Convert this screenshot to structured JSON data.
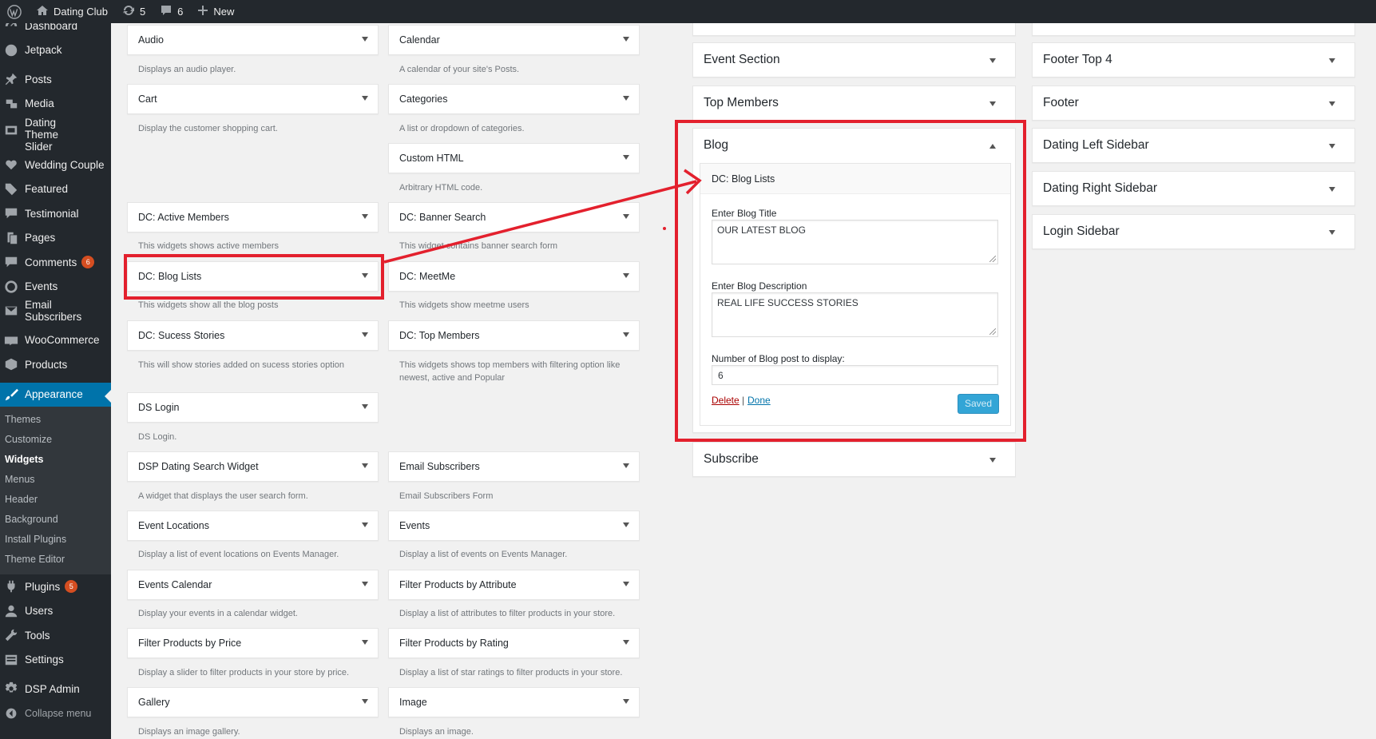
{
  "adminbar": {
    "site_name": "Dating Club",
    "updates_count": "5",
    "comments_count": "6",
    "new_label": "New"
  },
  "menu": {
    "items": [
      {
        "label": "Dashboard",
        "icon": "dashboard-icon"
      },
      {
        "label": "Jetpack",
        "icon": "jetpack-icon"
      },
      {
        "label": "Posts",
        "icon": "pin-icon"
      },
      {
        "label": "Media",
        "icon": "media-icon"
      },
      {
        "label": "Dating Theme Slider",
        "icon": "slider-icon"
      },
      {
        "label": "Wedding Couple",
        "icon": "heart-icon"
      },
      {
        "label": "Featured",
        "icon": "tag-icon"
      },
      {
        "label": "Testimonial",
        "icon": "speech-bubble-icon"
      },
      {
        "label": "Pages",
        "icon": "pages-icon"
      },
      {
        "label": "Comments",
        "icon": "comment-icon",
        "badge": "6"
      },
      {
        "label": "Events",
        "icon": "events-icon"
      },
      {
        "label": "Email Subscribers",
        "icon": "email-icon"
      },
      {
        "label": "WooCommerce",
        "icon": "woocommerce-icon"
      },
      {
        "label": "Products",
        "icon": "products-icon"
      },
      {
        "label": "Appearance",
        "icon": "paintbrush-icon"
      },
      {
        "label": "Plugins",
        "icon": "plugin-icon",
        "badge": "5"
      },
      {
        "label": "Users",
        "icon": "users-icon"
      },
      {
        "label": "Tools",
        "icon": "wrench-icon"
      },
      {
        "label": "Settings",
        "icon": "settings-icon"
      },
      {
        "label": "DSP Admin",
        "icon": "gear-icon"
      },
      {
        "label": "Collapse menu",
        "icon": "collapse-icon"
      }
    ],
    "appearance_sub": [
      "Themes",
      "Customize",
      "Widgets",
      "Menus",
      "Header",
      "Background",
      "Install Plugins",
      "Theme Editor"
    ],
    "current_sub": "Widgets"
  },
  "available_widgets": {
    "left": [
      {
        "title": "Audio",
        "desc": "Displays an audio player."
      },
      {
        "title": "Cart",
        "desc": "Display the customer shopping cart."
      },
      {
        "title": "DC: Active Members",
        "desc": "This widgets shows active members"
      },
      {
        "title": "DC: Blog Lists",
        "desc": "This widgets show all the blog posts"
      },
      {
        "title": "DC: Sucess Stories",
        "desc": "This will show stories added on sucess stories option"
      },
      {
        "title": "DS Login",
        "desc": "DS Login."
      },
      {
        "title": "DSP Dating Search Widget",
        "desc": "A widget that displays the user search form."
      },
      {
        "title": "Event Locations",
        "desc": "Display a list of event locations on Events Manager."
      },
      {
        "title": "Events Calendar",
        "desc": "Display your events in a calendar widget."
      },
      {
        "title": "Filter Products by Price",
        "desc": "Display a slider to filter products in your store by price."
      },
      {
        "title": "Gallery",
        "desc": "Displays an image gallery."
      }
    ],
    "right": [
      {
        "title": "Calendar",
        "desc": "A calendar of your site's Posts."
      },
      {
        "title": "Categories",
        "desc": "A list or dropdown of categories."
      },
      {
        "title": "Custom HTML",
        "desc": "Arbitrary HTML code."
      },
      {
        "title": "DC: Banner Search",
        "desc": "This widget contains banner search form"
      },
      {
        "title": "DC: MeetMe",
        "desc": "This widgets show meetme users"
      },
      {
        "title": "DC: Top Members",
        "desc": "This widgets shows top members with filtering option like newest, active and Popular"
      },
      {
        "title": "Email Subscribers",
        "desc": "Email Subscribers Form"
      },
      {
        "title": "Events",
        "desc": "Display a list of events on Events Manager."
      },
      {
        "title": "Filter Products by Attribute",
        "desc": "Display a list of attributes to filter products in your store."
      },
      {
        "title": "Filter Products by Rating",
        "desc": "Display a list of star ratings to filter products in your store."
      },
      {
        "title": "Image",
        "desc": "Displays an image."
      }
    ]
  },
  "sidebars": {
    "col1": [
      "Event Section",
      "Top Members",
      "Blog",
      "Subscribe"
    ],
    "col2": [
      "Footer Top 4",
      "Footer",
      "Dating Left Sidebar",
      "Dating Right Sidebar",
      "Login Sidebar"
    ]
  },
  "blog_widget": {
    "title": "DC: Blog Lists",
    "title_label": "Enter Blog Title",
    "title_value": "OUR LATEST BLOG",
    "desc_label": "Enter Blog Description",
    "desc_value": "REAL LIFE SUCCESS STORIES",
    "count_label": "Number of Blog post to display:",
    "count_value": "6",
    "delete_label": "Delete",
    "separator": "|",
    "done_label": "Done",
    "saved_label": "Saved"
  },
  "colors": {
    "annotation_red": "#e3202d",
    "admin_dark": "#23282d",
    "active_blue": "#0073aa"
  }
}
